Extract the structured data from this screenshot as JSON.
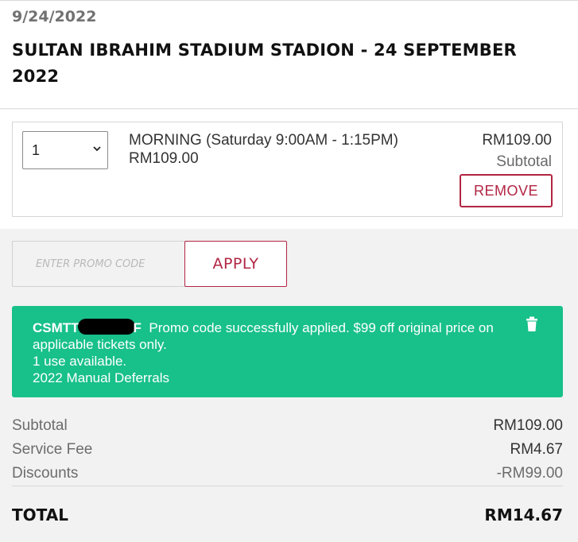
{
  "event": {
    "date": "9/24/2022",
    "title": "SULTAN IBRAHIM STADIUM STADION - 24 SEPTEMBER 2022"
  },
  "ticket": {
    "quantity": "1",
    "session_name": "MORNING (Saturday 9:00AM - 1:15PM)",
    "unit_price": "RM109.00",
    "line_total": "RM109.00",
    "line_total_label": "Subtotal",
    "remove_label": "REMOVE"
  },
  "promo": {
    "placeholder": "ENTER PROMO CODE",
    "apply_label": "APPLY"
  },
  "promo_banner": {
    "code_prefix": "CSMTT",
    "code_suffix": "F",
    "message": "Promo code successfully applied.  $99 off original price on",
    "message_cont": "applicable tickets only.",
    "uses": "1 use available.",
    "note": "2022 Manual Deferrals",
    "bg_color": "#18c08a"
  },
  "summary": {
    "subtotal_label": "Subtotal",
    "subtotal_value": "RM109.00",
    "fee_label": "Service Fee",
    "fee_value": "RM4.67",
    "discount_label": "Discounts",
    "discount_value": "-RM99.00",
    "total_label": "TOTAL",
    "total_value": "RM14.67"
  },
  "colors": {
    "accent": "#b22543",
    "success": "#18c08a"
  },
  "icons": {
    "select": "chevron-down-icon",
    "delete": "trash-icon"
  }
}
